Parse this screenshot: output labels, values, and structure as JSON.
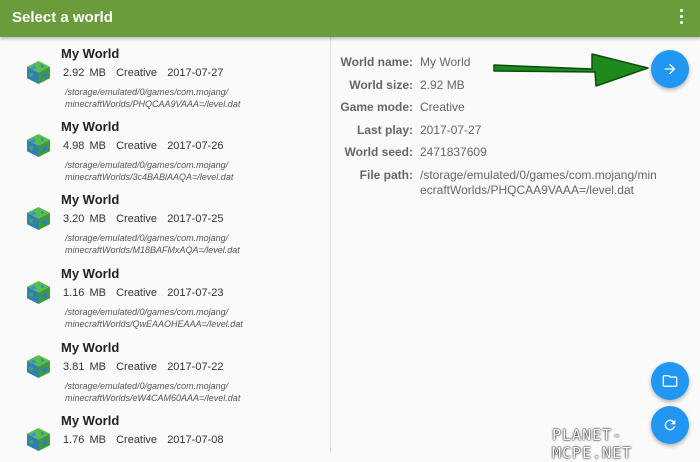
{
  "appbar": {
    "title": "Select a world",
    "menu_icon": "more-vert-icon"
  },
  "colors": {
    "appbar": "#6a9c3b",
    "fab": "#2196f3",
    "arrow": "#1e8a1e"
  },
  "worlds": [
    {
      "name": "My World",
      "size": "2.92 MB",
      "mode": "Creative",
      "date": "2017-07-27",
      "path1": "/storage/emulated/0/games/com.mojang/",
      "path2": "minecraftWorlds/PHQCAA9VAAA=/level.dat"
    },
    {
      "name": "My World",
      "size": "4.98 MB",
      "mode": "Creative",
      "date": "2017-07-26",
      "path1": "/storage/emulated/0/games/com.mojang/",
      "path2": "minecraftWorlds/3c4BABlAAQA=/level.dat"
    },
    {
      "name": "My World",
      "size": "3.20 MB",
      "mode": "Creative",
      "date": "2017-07-25",
      "path1": "/storage/emulated/0/games/com.mojang/",
      "path2": "minecraftWorlds/M18BAFMxAQA=/level.dat"
    },
    {
      "name": "My World",
      "size": "1.16 MB",
      "mode": "Creative",
      "date": "2017-07-23",
      "path1": "/storage/emulated/0/games/com.mojang/",
      "path2": "minecraftWorlds/QwEAAOHEAAA=/level.dat"
    },
    {
      "name": "My World",
      "size": "3.81 MB",
      "mode": "Creative",
      "date": "2017-07-22",
      "path1": "/storage/emulated/0/games/com.mojang/",
      "path2": "minecraftWorlds/eW4CAM60AAA=/level.dat"
    },
    {
      "name": "My World",
      "size": "1.76 MB",
      "mode": "Creative",
      "date": "2017-07-08",
      "path1": "",
      "path2": ""
    }
  ],
  "details": {
    "world_name_label": "World name:",
    "world_name": "My World",
    "world_size_label": "World size:",
    "world_size": "2.92 MB",
    "game_mode_label": "Game mode:",
    "game_mode": "Creative",
    "last_play_label": "Last play:",
    "last_play": "2017-07-27",
    "world_seed_label": "World seed:",
    "world_seed": "2471837609",
    "file_path_label": "File path:",
    "file_path": "/storage/emulated/0/games/com.mojang/minecraftWorlds/PHQCAA9VAAA=/level.dat"
  },
  "fabs": {
    "go": "arrow-forward-icon",
    "folder": "folder-icon",
    "refresh": "refresh-icon"
  },
  "watermark": "PLANET-MCPE.NET"
}
